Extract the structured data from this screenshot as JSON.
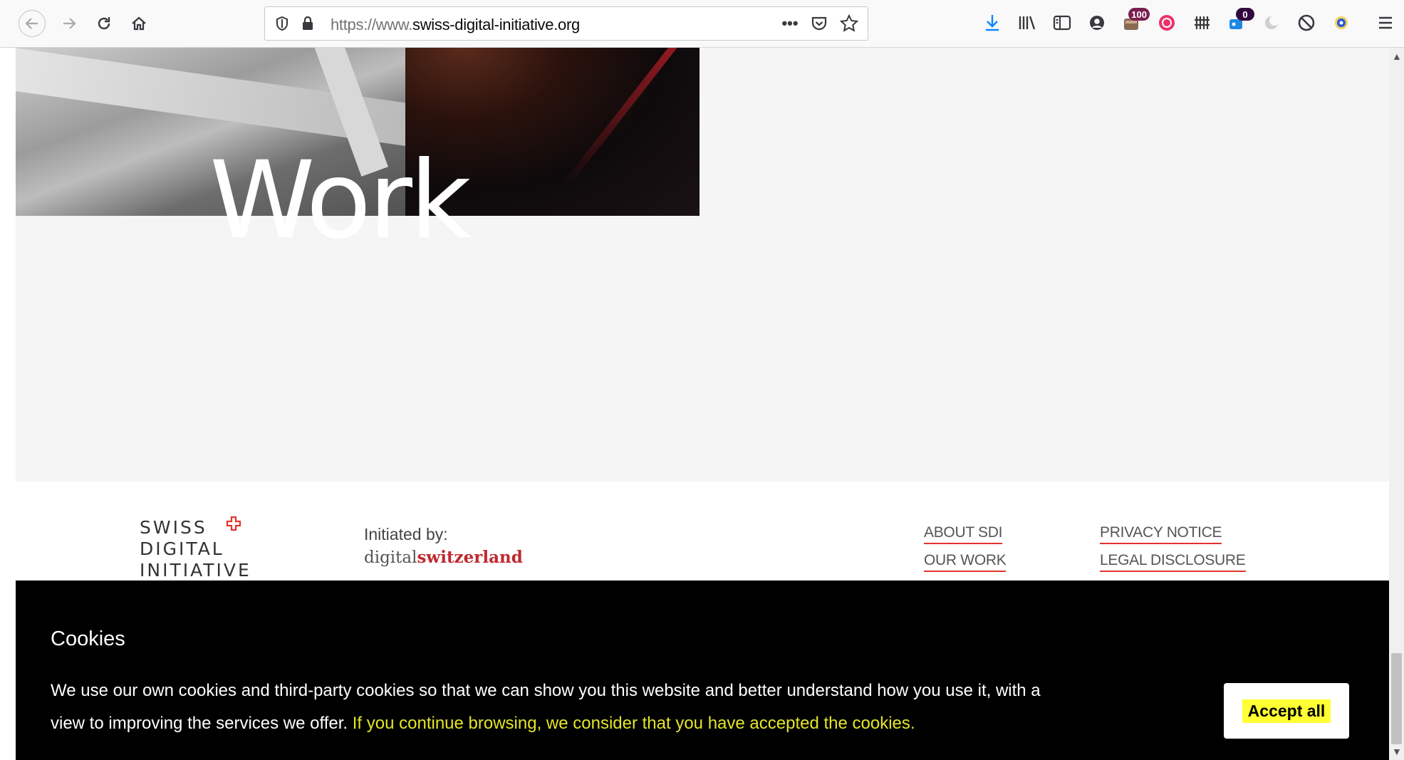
{
  "browser": {
    "url_protocol": "https://www.",
    "url_domain": "swiss-digital-initiative.org",
    "menu_dots": "•••",
    "badges": {
      "container": "100",
      "notes": "0"
    }
  },
  "hero": {
    "word": "Work"
  },
  "footer": {
    "logo_lines": [
      "SWISS",
      "DIGITAL",
      "INITIATIVE"
    ],
    "initiated_label": "Initiated by:",
    "initiated_brand_a": "digital",
    "initiated_brand_b": "switzerland",
    "links": {
      "about": "ABOUT SDI",
      "work": "OUR WORK",
      "privacy": "PRIVACY NOTICE",
      "legal": "LEGAL DISCLOSURE"
    },
    "accent_color": "#e3342f"
  },
  "cookie": {
    "title": "Cookies",
    "text_plain": "We use our own cookies and third-party cookies so that we can show you this website and better understand how you use it, with a view to improving the services we offer. ",
    "text_highlight": "If you continue browsing, we consider that you have accepted the cookies.",
    "accept_label": "Accept all",
    "highlight_color": "#e5e52a"
  }
}
